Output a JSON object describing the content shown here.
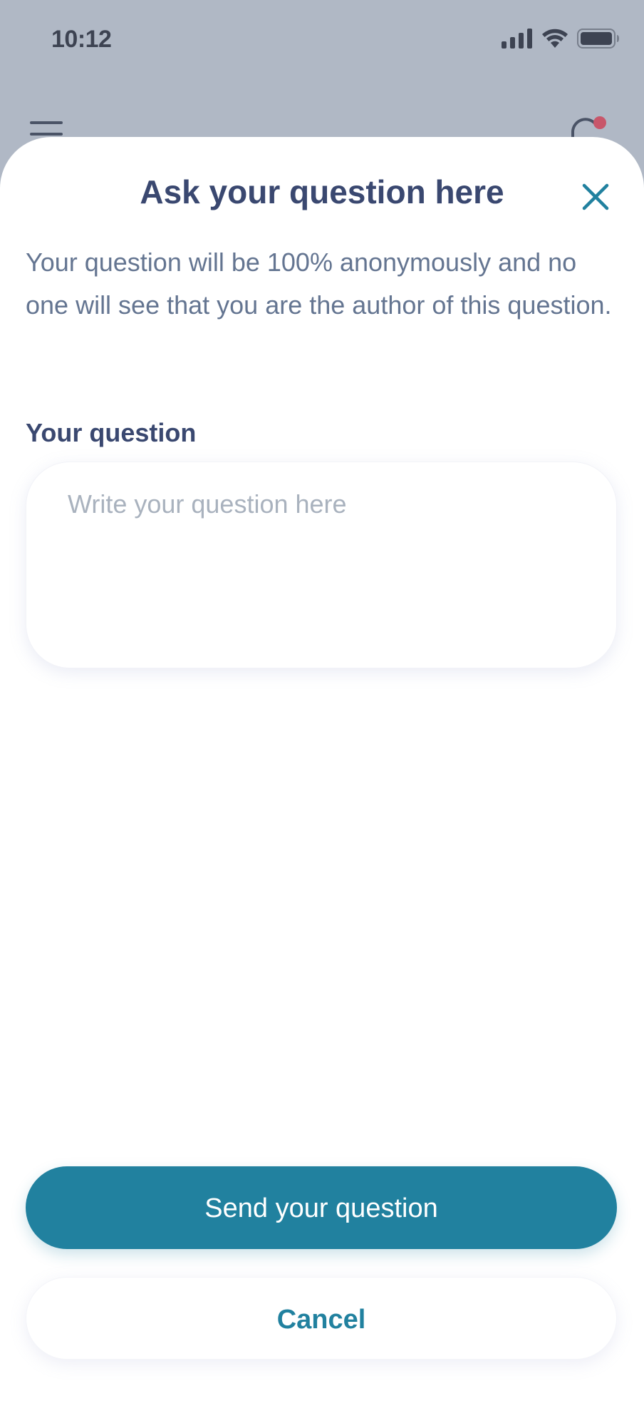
{
  "status_bar": {
    "time": "10:12",
    "icons": [
      "cellular-signal-icon",
      "wifi-icon",
      "battery-icon"
    ]
  },
  "background_header": {
    "icons": [
      "hamburger-menu-icon",
      "notification-bell-icon"
    ]
  },
  "sheet": {
    "title": "Ask your question here",
    "close_icon": "close-icon",
    "description": "Your question will be 100% anonymously and no one will see that you are the author of this question.",
    "field_label": "Your question",
    "input": {
      "value": "",
      "placeholder": "Write your question here"
    },
    "send_label": "Send your question",
    "cancel_label": "Cancel"
  },
  "colors": {
    "accent": "#21819f",
    "title_text": "#3a4870",
    "body_text": "#647591",
    "placeholder_text": "#a9b2be",
    "overlay": "#b0b8c5",
    "notification_dot": "#c8566a"
  }
}
